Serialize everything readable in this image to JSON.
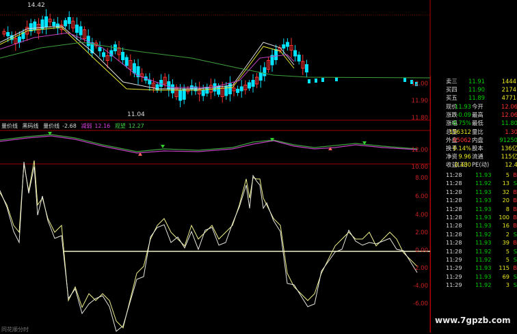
{
  "colors": {
    "up": "#ff3030",
    "down": "#00e5ff",
    "ma_white": "#e0e0e0",
    "ma_yellow": "#e8e830",
    "ma_purple": "#c040c0",
    "ma_green": "#40a040",
    "osc_line": "#f0f090",
    "grid_red": "#800000",
    "text_yellow": "#e8e820",
    "text_red": "#ff3030",
    "text_green": "#00d000"
  },
  "price_chart": {
    "high_label": "14.42",
    "low_label": "11.04"
  },
  "indicator_legend": {
    "name1": "量价线",
    "name2": "黑码线",
    "name3": "量价线",
    "v3": "-2.68",
    "name4": "减弱",
    "v4": "12.16",
    "name5": "观望",
    "v5": "12.27"
  },
  "axis_labels": {
    "price": [
      "12.00",
      "11.90",
      "11.80"
    ],
    "indicator": [
      "12.00",
      "10.00"
    ],
    "oscillator": [
      "8.00",
      "6.00",
      "4.00",
      "2.00",
      "0.00",
      "-2.00",
      "-4.00",
      "-6.00"
    ]
  },
  "quote_panel": {
    "order_book": [
      {
        "label": "卖三",
        "price": "11.91",
        "vol": "1444",
        "color": "green"
      },
      {
        "label": "买四",
        "price": "11.90",
        "vol": "2174",
        "color": "green"
      },
      {
        "label": "买五",
        "price": "11.89",
        "vol": "4771",
        "color": "green"
      }
    ],
    "stats": [
      {
        "l1": "现价",
        "v1": "11.93",
        "l2": "今开",
        "v2": "12.06",
        "c1": "green",
        "c2": "red"
      },
      {
        "l1": "涨跌",
        "v1": "-0.09",
        "l2": "最高",
        "v2": "12.06",
        "c1": "green",
        "c2": "red"
      },
      {
        "l1": "涨幅",
        "v1": "-0.75%",
        "l2": "最低",
        "v2": "11.80",
        "c1": "green",
        "c2": "green"
      },
      {
        "l1": "总量",
        "v1": "156312",
        "l2": "量比",
        "v2": "1.30",
        "c1": "yellow",
        "c2": "red"
      },
      {
        "l1": "外盘",
        "v1": "65062",
        "l2": "内盘",
        "v2": "91250",
        "c1": "red",
        "c2": "green"
      },
      {
        "l1": "换手",
        "v1": "0.14%",
        "l2": "股本",
        "v2": "136亿",
        "c1": "yellow",
        "c2": "yellow"
      },
      {
        "l1": "净资",
        "v1": "9.96",
        "l2": "流通",
        "v2": "115亿",
        "c1": "yellow",
        "c2": "yellow"
      },
      {
        "l1": "收益(三)",
        "v1": "0.480",
        "l2": "PE(动)",
        "v2": "12.4",
        "c1": "yellow",
        "c2": "yellow"
      }
    ],
    "ticks": [
      {
        "time": "11:28",
        "price": "11.93",
        "vol": "5",
        "side": "B"
      },
      {
        "time": "11:28",
        "price": "11.92",
        "vol": "13",
        "side": "S"
      },
      {
        "time": "11:28",
        "price": "11.93",
        "vol": "32",
        "side": "B"
      },
      {
        "time": "11:28",
        "price": "11.93",
        "vol": "20",
        "side": "B"
      },
      {
        "time": "11:28",
        "price": "11.93",
        "vol": "8",
        "side": "B"
      },
      {
        "time": "11:28",
        "price": "11.93",
        "vol": "100",
        "side": "B"
      },
      {
        "time": "11:28",
        "price": "11.93",
        "vol": "16",
        "side": "B"
      },
      {
        "time": "11:28",
        "price": "11.92",
        "vol": "2",
        "side": "S"
      },
      {
        "time": "11:28",
        "price": "11.93",
        "vol": "39",
        "side": "B"
      },
      {
        "time": "11:28",
        "price": "11.92",
        "vol": "5",
        "side": "S"
      },
      {
        "time": "11:29",
        "price": "11.92",
        "vol": "5",
        "side": "S"
      },
      {
        "time": "11:29",
        "price": "11.93",
        "vol": "115",
        "side": "B"
      },
      {
        "time": "11:29",
        "price": "11.93",
        "vol": "69",
        "side": "S"
      },
      {
        "time": "11:29",
        "price": "11.92",
        "vol": "3",
        "side": "S"
      }
    ]
  },
  "watermark": "www.7gpzb.com",
  "bottom_text": "同花顺分时"
}
